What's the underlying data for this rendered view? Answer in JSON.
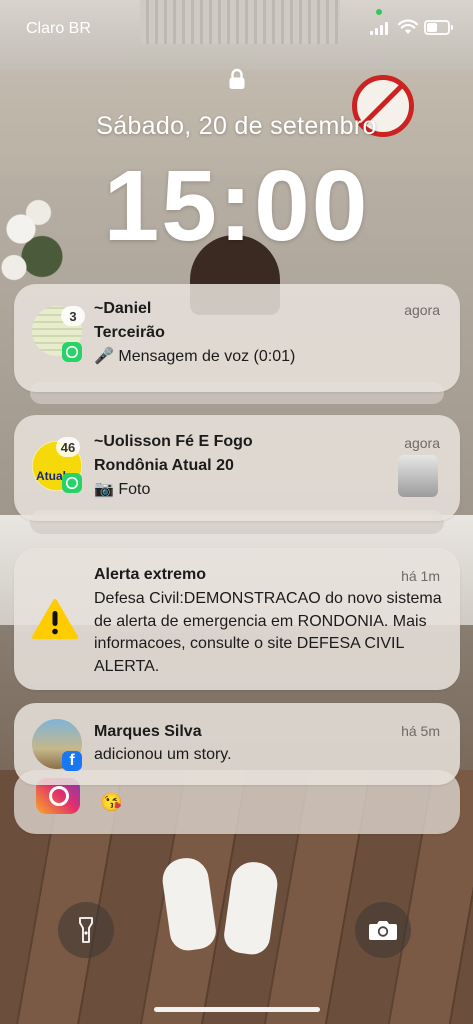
{
  "status_bar": {
    "carrier": "Claro BR"
  },
  "lock_screen": {
    "date": "Sábado, 20 de setembro",
    "time": "15:00"
  },
  "notifications": [
    {
      "app": "WhatsApp",
      "title": "~Daniel",
      "subtitle": "Terceirão",
      "message": "Mensagem de voz (0:01)",
      "message_icon": "microphone-emoji",
      "time": "agora",
      "count": "3"
    },
    {
      "app": "WhatsApp",
      "title": "~Uolisson Fé E Fogo",
      "subtitle": "Rondônia Atual  20",
      "message": "Foto",
      "message_icon": "camera-emoji",
      "time": "agora",
      "count": "46",
      "icon_text": "Atual"
    },
    {
      "app": "Emergency Alert",
      "title": "Alerta extremo",
      "message": "Defesa Civil:DEMONSTRACAO do novo sistema de alerta de emergencia em RONDONIA. Mais informacoes, consulte o site DEFESA CIVIL ALERTA.",
      "time": "há 1m"
    },
    {
      "app": "Facebook",
      "title": "Marques Silva",
      "message": "adicionou um story.",
      "time": "há 5m"
    },
    {
      "app": "Instagram",
      "message_icon": "kiss-emoji"
    }
  ],
  "colors": {
    "whatsapp": "#25d366",
    "facebook": "#1877f2",
    "alert": "#ffcc00"
  }
}
